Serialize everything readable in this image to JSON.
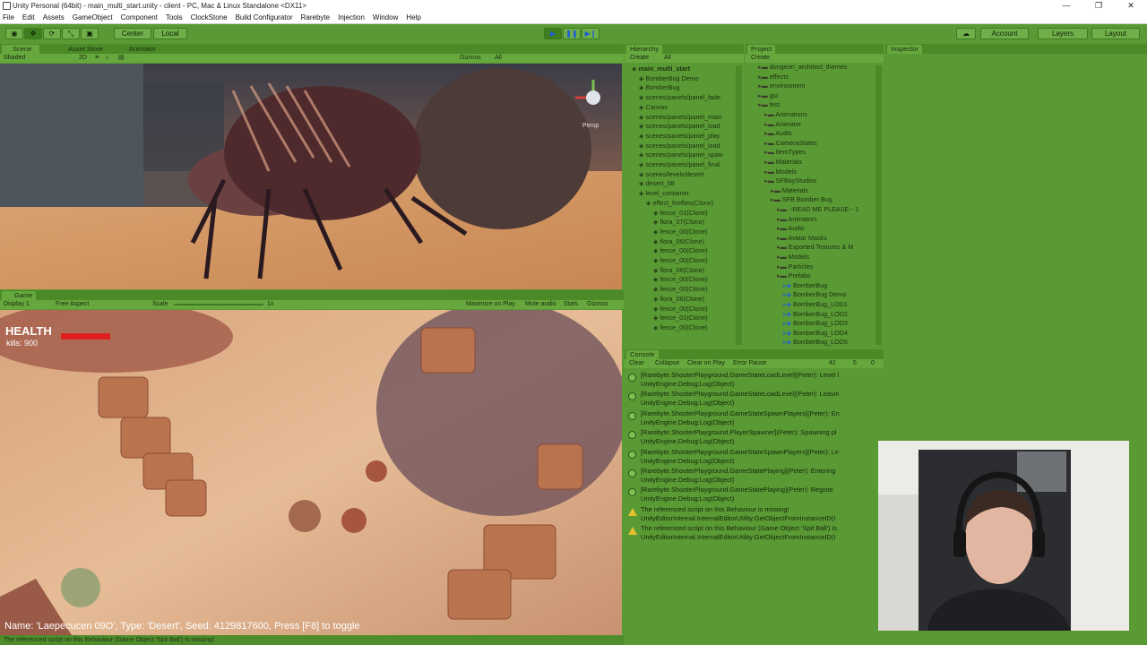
{
  "window": {
    "title": "Unity Personal (64bit) - main_multi_start.unity - client - PC, Mac & Linux Standalone <DX11>",
    "controls": [
      "—",
      "❐",
      "✕"
    ]
  },
  "menu": [
    "File",
    "Edit",
    "Assets",
    "GameObject",
    "Component",
    "Tools",
    "ClockStone",
    "Build Configurator",
    "Rarebyte",
    "Injection",
    "Window",
    "Help"
  ],
  "toolbar": {
    "pivot": "Center",
    "space": "Local",
    "account": "Account",
    "layers": "Layers",
    "layout": "Layout"
  },
  "scene": {
    "tabs": [
      "Scene",
      "Asset Store",
      "Animator"
    ],
    "shading": "Shaded",
    "mode2d": "2D",
    "gizmos": "Gizmos",
    "search": "All",
    "persp": "Persp"
  },
  "game": {
    "tab": "Game",
    "display": "Display 1",
    "aspect": "Free Aspect",
    "scale_label": "Scale",
    "scale_value": "1x",
    "options": [
      "Maximize on Play",
      "Mute audio",
      "Stats",
      "Gizmos"
    ],
    "health_label": "HEALTH",
    "kills": "kills: 900",
    "info": "Name: 'Laepecucen 09O', Type: 'Desert', Seed: 4129817600, Press [F8] to toggle"
  },
  "hierarchy": {
    "tab": "Hierarchy",
    "create": "Create",
    "search": "All",
    "rows": [
      {
        "label": "main_multi_start",
        "bold": true
      },
      {
        "label": "BomberBug Demo"
      },
      {
        "label": "BomberBug"
      },
      {
        "label": "scenes/panels/panel_fade"
      },
      {
        "label": "Canvas"
      },
      {
        "label": "scenes/panels/panel_main"
      },
      {
        "label": "scenes/panels/panel_load"
      },
      {
        "label": "scenes/panels/panel_play"
      },
      {
        "label": "scenes/panels/panel_load"
      },
      {
        "label": "scenes/panels/panel_spaw"
      },
      {
        "label": "scenes/panels/panel_final"
      },
      {
        "label": "scenes/levels/desert"
      },
      {
        "label": "desert_08"
      },
      {
        "label": "level_container"
      },
      {
        "label": "effect_fireflies(Clone)"
      },
      {
        "label": "fence_01(Clone)"
      },
      {
        "label": "flora_07(Clone)"
      },
      {
        "label": "fence_00(Clone)"
      },
      {
        "label": "flora_06(Clone)"
      },
      {
        "label": "fence_00(Clone)"
      },
      {
        "label": "fence_00(Clone)"
      },
      {
        "label": "flora_06(Clone)"
      },
      {
        "label": "fence_00(Clone)"
      },
      {
        "label": "fence_00(Clone)"
      },
      {
        "label": "flora_06(Clone)"
      },
      {
        "label": "fence_00(Clone)"
      },
      {
        "label": "fence_01(Clone)"
      },
      {
        "label": "fence_00(Clone)"
      }
    ]
  },
  "project": {
    "tab": "Project",
    "create": "Create",
    "rows": [
      {
        "label": "dungeon_architect_themes"
      },
      {
        "label": "effects"
      },
      {
        "label": "environment"
      },
      {
        "label": "gui"
      },
      {
        "label": "test"
      },
      {
        "label": "Animations"
      },
      {
        "label": "Animator"
      },
      {
        "label": "Audio"
      },
      {
        "label": "CameraStates"
      },
      {
        "label": "ItemTypes"
      },
      {
        "label": "Materials"
      },
      {
        "label": "Models"
      },
      {
        "label": "SFBayStudios"
      },
      {
        "label": "Materials"
      },
      {
        "label": "SFB Bomber Bug"
      },
      {
        "label": "--READ ME PLEASE-- 1"
      },
      {
        "label": "Animators"
      },
      {
        "label": "Audio"
      },
      {
        "label": "Avatar Masks"
      },
      {
        "label": "Exported Textures & M"
      },
      {
        "label": "Models"
      },
      {
        "label": "Particles"
      },
      {
        "label": "Prefabs"
      },
      {
        "label": "BomberBug"
      },
      {
        "label": "BomberBug Demo"
      },
      {
        "label": "BomberBug_LOD1"
      },
      {
        "label": "BomberBug_LOD2"
      },
      {
        "label": "BomberBug_LOD3"
      },
      {
        "label": "BomberBug_LOD4"
      },
      {
        "label": "BomberBug_LOD5"
      }
    ]
  },
  "inspector": {
    "tab": "Inspector"
  },
  "console": {
    "tab": "Console",
    "buttons": [
      "Clear",
      "Collapse",
      "Clear on Play",
      "Error Pause"
    ],
    "counts": [
      "42",
      "5",
      "0"
    ],
    "entries": [
      {
        "type": "info",
        "line1": "[Rarebyte.ShooterPlayground.GameStateLoadLevel](Peter): Level l",
        "line2": "UnityEngine.Debug:Log(Object)"
      },
      {
        "type": "info",
        "line1": "[Rarebyte.ShooterPlayground.GameStateLoadLevel](Peter): Leavin",
        "line2": "UnityEngine.Debug:Log(Object)"
      },
      {
        "type": "info",
        "line1": "[Rarebyte.ShooterPlayground.GameStateSpawnPlayers](Peter): En",
        "line2": "UnityEngine.Debug:Log(Object)"
      },
      {
        "type": "info",
        "line1": "[Rarebyte.ShooterPlayground.PlayerSpawner](Peter): Spawning pl",
        "line2": "UnityEngine.Debug:Log(Object)"
      },
      {
        "type": "info",
        "line1": "[Rarebyte.ShooterPlayground.GameStateSpawnPlayers](Peter): Le",
        "line2": "UnityEngine.Debug:Log(Object)"
      },
      {
        "type": "info",
        "line1": "[Rarebyte.ShooterPlayground.GameStatePlaying](Peter): Entering",
        "line2": "UnityEngine.Debug:Log(Object)"
      },
      {
        "type": "info",
        "line1": "[Rarebyte.ShooterPlayground.GameStatePlaying](Peter): Registe",
        "line2": "UnityEngine.Debug:Log(Object)"
      },
      {
        "type": "warn",
        "line1": "The referenced script on this Behaviour is missing!",
        "line2": "UnityEditorInternal.InternalEditorUtility:GetObjectFromInstanceID(I"
      },
      {
        "type": "warn",
        "line1": "The referenced script on this Behaviour (Game Object 'Spit Ball') is",
        "line2": "UnityEditorInternal.InternalEditorUtility:GetObjectFromInstanceID(I"
      }
    ]
  },
  "status": {
    "message": "The referenced script on this Behaviour (Game Object 'Spit Ball') is missing!"
  },
  "colors": {
    "editor_green": "#5a9a34",
    "tab_green": "#66a83d",
    "health_red": "#e02020",
    "warn_yellow": "#e6c12e"
  }
}
